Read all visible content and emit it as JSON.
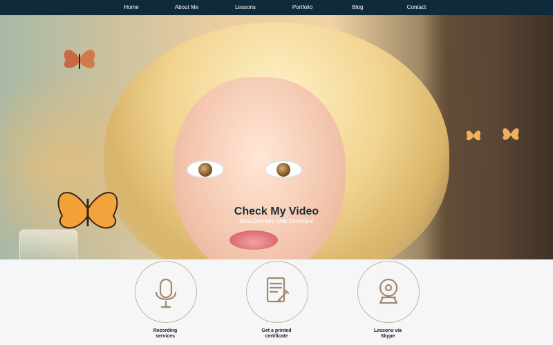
{
  "nav": {
    "items": [
      "Home",
      "About Me",
      "Lessons",
      "Portfolio",
      "Blog",
      "Contact"
    ]
  },
  "hero": {
    "title": "Check My Video",
    "subtitle": "Silvia Damiani Web Developer"
  },
  "services": [
    {
      "label_line1": "Recording",
      "label_line2": "services",
      "icon": "microphone-icon"
    },
    {
      "label_line1": "Get a printed",
      "label_line2": "certificate",
      "icon": "certificate-icon"
    },
    {
      "label_line1": "Lessons via",
      "label_line2": "Skype",
      "icon": "webcam-icon"
    }
  ],
  "colors": {
    "nav_bg": "#0f2a3a",
    "nav_text": "#ffffff",
    "accent_icon": "#a08870",
    "circle_border": "#c6b39c"
  }
}
